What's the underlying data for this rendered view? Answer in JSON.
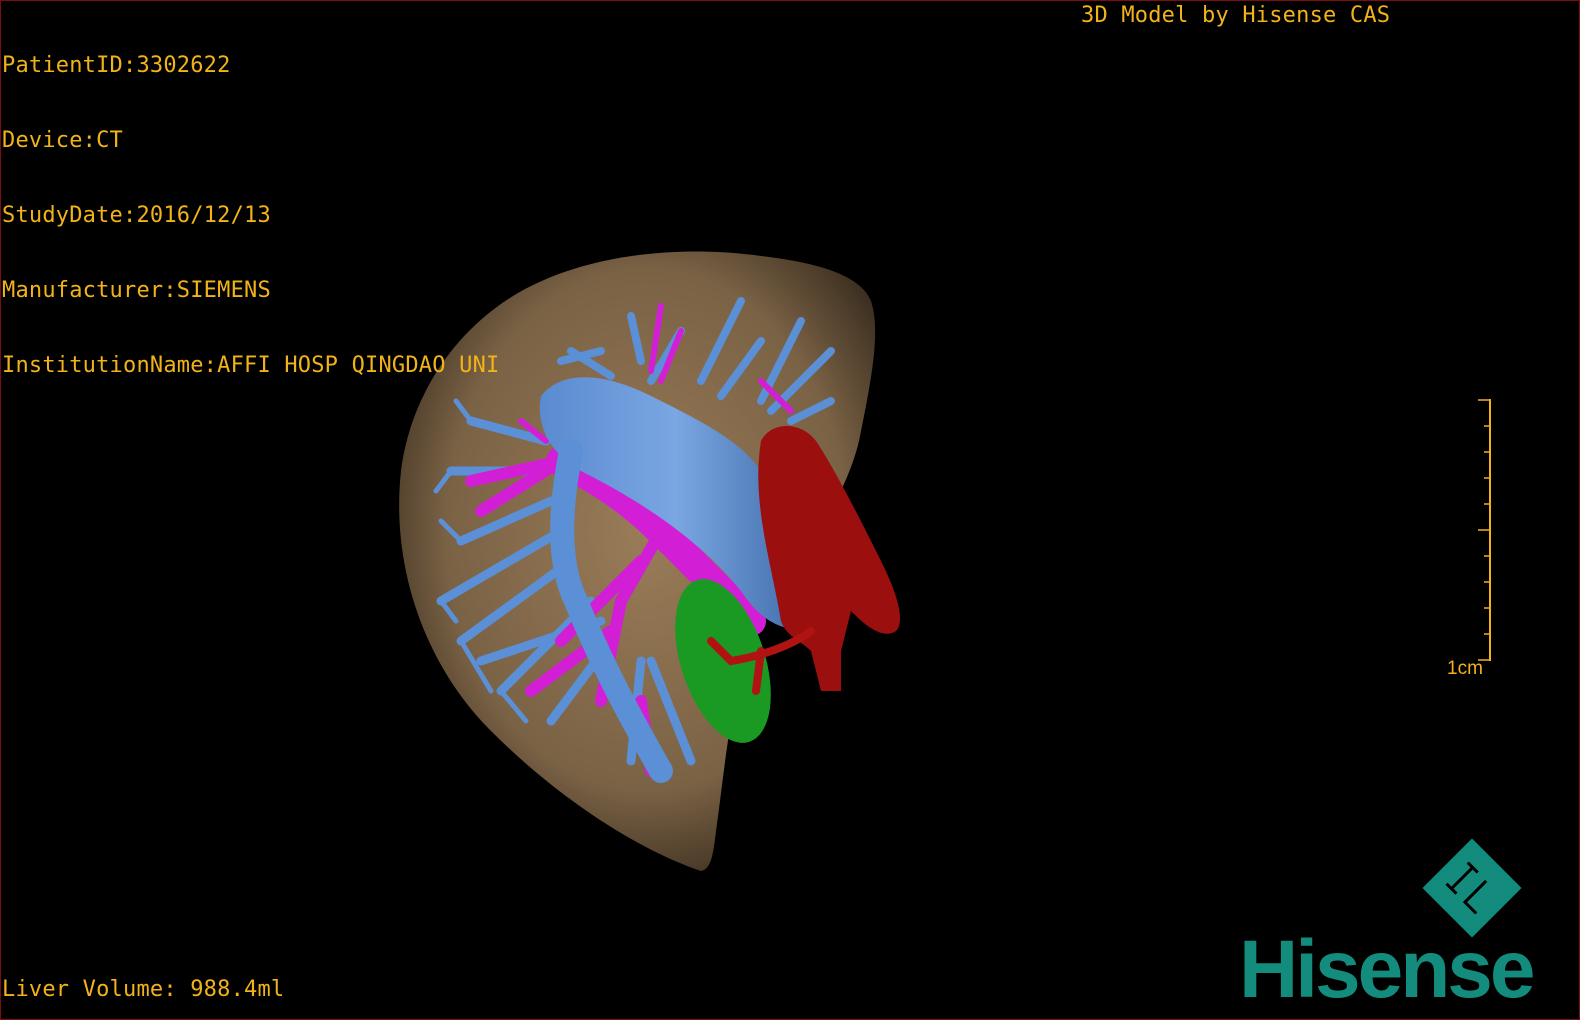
{
  "patient_info": {
    "patient_id": "PatientID:3302622",
    "device": "Device:CT",
    "study_date": "StudyDate:2016/12/13",
    "manufacturer": "Manufacturer:SIEMENS",
    "institution": "InstitutionName:AFFI HOSP QINGDAO UNI"
  },
  "header": {
    "model_credit": "3D Model by Hisense CAS"
  },
  "footer": {
    "liver_volume": "Liver Volume: 988.4ml"
  },
  "scale": {
    "label": "1cm"
  },
  "brand": {
    "wordmark": "Hisense",
    "color": "#138b7d"
  },
  "model_colors": {
    "liver": "#8a7050",
    "hepatic_vein": "#5b8fd6",
    "portal_vein": "#d21fd6",
    "ivc": "#9c0f0f",
    "gallbladder": "#1a9a22"
  },
  "theme": {
    "text_color": "#f2b31a",
    "background": "#000000"
  }
}
